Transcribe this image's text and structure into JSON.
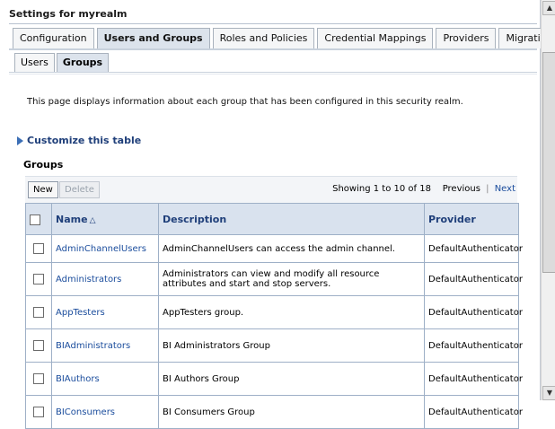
{
  "panel": {
    "title": "Settings for myrealm"
  },
  "tabs": [
    {
      "label": "Configuration",
      "active": false
    },
    {
      "label": "Users and Groups",
      "active": true
    },
    {
      "label": "Roles and Policies",
      "active": false
    },
    {
      "label": "Credential Mappings",
      "active": false
    },
    {
      "label": "Providers",
      "active": false
    },
    {
      "label": "Migration",
      "active": false
    }
  ],
  "subtabs": [
    {
      "label": "Users",
      "active": false
    },
    {
      "label": "Groups",
      "active": true
    }
  ],
  "intro_text": "This page displays information about each group that has been configured in this security realm.",
  "customize_label": "Customize this table",
  "groups_heading": "Groups",
  "toolbar": {
    "new_label": "New",
    "delete_label": "Delete",
    "showing": "Showing 1 to 10 of 18",
    "previous": "Previous",
    "separator": "|",
    "next": "Next"
  },
  "table": {
    "columns": [
      "Name",
      "Description",
      "Provider"
    ],
    "sort_icon": "sort-ascending-icon",
    "rows": [
      {
        "name": "AdminChannelUsers",
        "description": "AdminChannelUsers can access the admin channel.",
        "provider": "DefaultAuthenticator"
      },
      {
        "name": "Administrators",
        "description": "Administrators can view and modify all resource attributes and start and stop servers.",
        "provider": "DefaultAuthenticator"
      },
      {
        "name": "AppTesters",
        "description": "AppTesters group.",
        "provider": "DefaultAuthenticator"
      },
      {
        "name": "BIAdministrators",
        "description": "BI Administrators Group",
        "provider": "DefaultAuthenticator"
      },
      {
        "name": "BIAuthors",
        "description": "BI Authors Group",
        "provider": "DefaultAuthenticator"
      },
      {
        "name": "BIConsumers",
        "description": "BI Consumers Group",
        "provider": "DefaultAuthenticator"
      }
    ]
  },
  "colors": {
    "header_bg": "#d9e2ee",
    "link": "#1a4c9c",
    "border": "#9eb0c7"
  }
}
